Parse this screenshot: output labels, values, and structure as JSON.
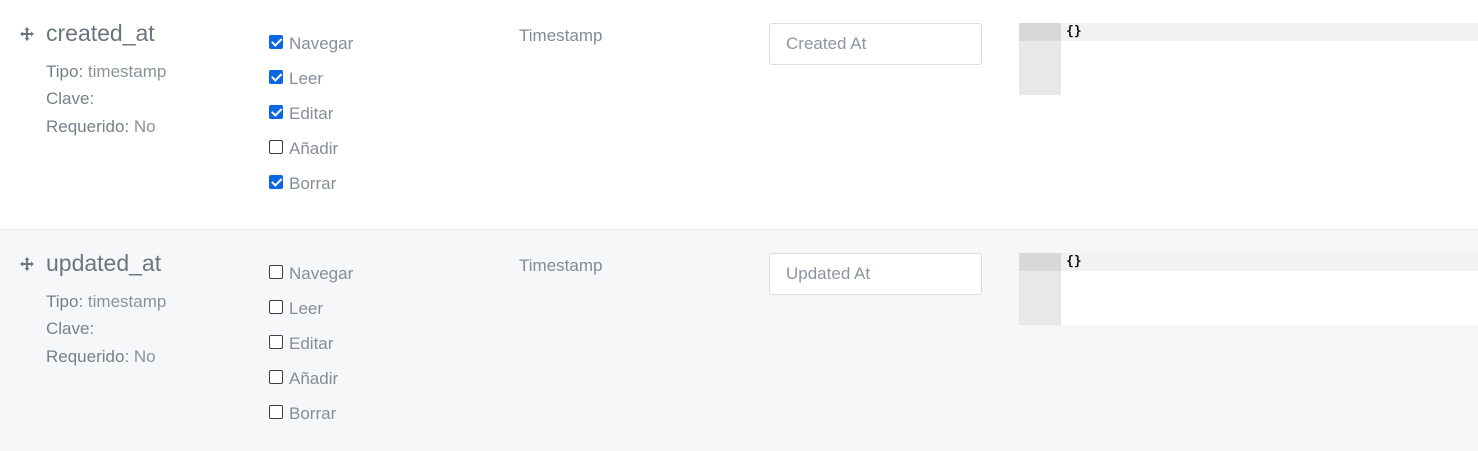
{
  "fields": [
    {
      "name": "created_at",
      "tipo_label": "Tipo:",
      "tipo": "timestamp",
      "clave_label": "Clave:",
      "clave": "",
      "requerido_label": "Requerido:",
      "requerido": "No",
      "permissions": [
        {
          "label": "Navegar",
          "checked": true
        },
        {
          "label": "Leer",
          "checked": true
        },
        {
          "label": "Editar",
          "checked": true
        },
        {
          "label": "Añadir",
          "checked": false
        },
        {
          "label": "Borrar",
          "checked": true
        }
      ],
      "input_type": "Timestamp",
      "display_name_placeholder": "Created At",
      "details_json": "{}"
    },
    {
      "name": "updated_at",
      "tipo_label": "Tipo:",
      "tipo": "timestamp",
      "clave_label": "Clave:",
      "clave": "",
      "requerido_label": "Requerido:",
      "requerido": "No",
      "permissions": [
        {
          "label": "Navegar",
          "checked": false
        },
        {
          "label": "Leer",
          "checked": false
        },
        {
          "label": "Editar",
          "checked": false
        },
        {
          "label": "Añadir",
          "checked": false
        },
        {
          "label": "Borrar",
          "checked": false
        }
      ],
      "input_type": "Timestamp",
      "display_name_placeholder": "Updated At",
      "details_json": "{}"
    }
  ],
  "colors": {
    "checkbox_checked": "#0b66e4",
    "row_alt_background": "#f6f7f9",
    "editor_gutter": "#e8e8e8"
  },
  "icons": {
    "drag_handle": "move-arrows-icon"
  }
}
